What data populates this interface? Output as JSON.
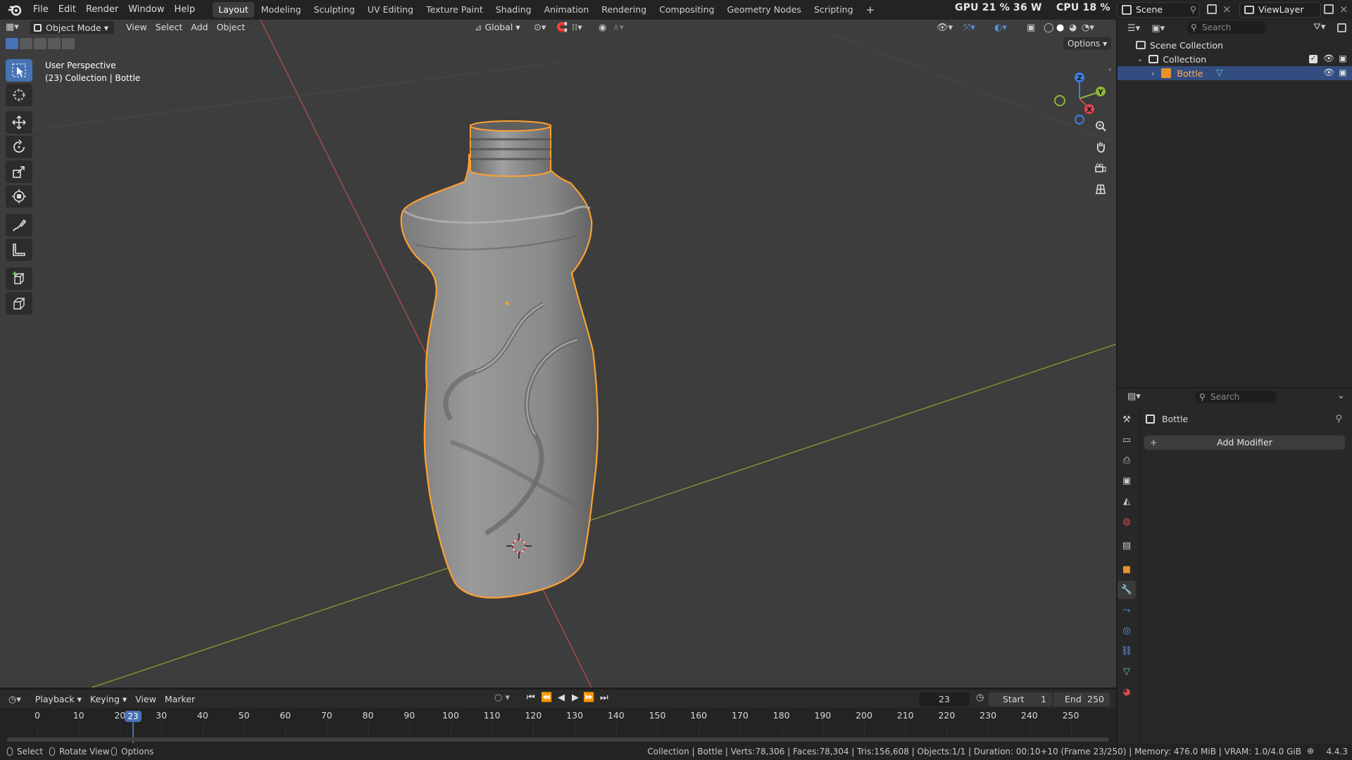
{
  "topbar": {
    "menus": [
      "File",
      "Edit",
      "Render",
      "Window",
      "Help"
    ],
    "workspaces": [
      "Layout",
      "Modeling",
      "Sculpting",
      "UV Editing",
      "Texture Paint",
      "Shading",
      "Animation",
      "Rendering",
      "Compositing",
      "Geometry Nodes",
      "Scripting"
    ],
    "active_workspace": "Layout",
    "add_tab": "+",
    "gpu": "GPU 21 %  36 W",
    "cpu": "CPU 18 %",
    "scene": "Scene",
    "view_layer": "ViewLayer"
  },
  "viewport": {
    "mode": "Object Mode",
    "menus": [
      "View",
      "Select",
      "Add",
      "Object"
    ],
    "orientation": "Global",
    "options": "Options",
    "overlay_title": "User Perspective",
    "overlay_sub": "(23) Collection | Bottle",
    "gizmo": {
      "z": "Z",
      "y": "Y",
      "x": "X"
    }
  },
  "outliner": {
    "search_placeholder": "Search",
    "rows": [
      {
        "label": "Scene Collection"
      },
      {
        "label": "Collection"
      },
      {
        "label": "Bottle"
      }
    ]
  },
  "properties": {
    "search_placeholder": "Search",
    "object_name": "Bottle",
    "add_modifier": "Add Modifier"
  },
  "timeline": {
    "menus": [
      "Playback",
      "Keying",
      "View",
      "Marker"
    ],
    "current_frame": "23",
    "start_label": "Start",
    "start": "1",
    "end_label": "End",
    "end": "250",
    "ticks": [
      "0",
      "10",
      "20",
      "30",
      "40",
      "50",
      "60",
      "70",
      "80",
      "90",
      "100",
      "110",
      "120",
      "130",
      "140",
      "150",
      "160",
      "170",
      "180",
      "190",
      "200",
      "210",
      "220",
      "230",
      "240",
      "250"
    ]
  },
  "statusbar": {
    "left": [
      "Select",
      "Rotate View",
      "Options"
    ],
    "info": "Collection | Bottle | Verts:78,306 | Faces:78,304 | Tris:156,608 | Objects:1/1 | Duration: 00:10+10 (Frame 23/250) | Memory: 476.0 MiB | VRAM: 1.0/4.0 GiB",
    "version": "4.4.3"
  },
  "colors": {
    "accent_blue": "#4772b3",
    "selection_orange": "#ffa030",
    "axis_x": "#c94b4b",
    "axis_y": "#8cb83a",
    "axis_z": "#3d7fe0"
  }
}
